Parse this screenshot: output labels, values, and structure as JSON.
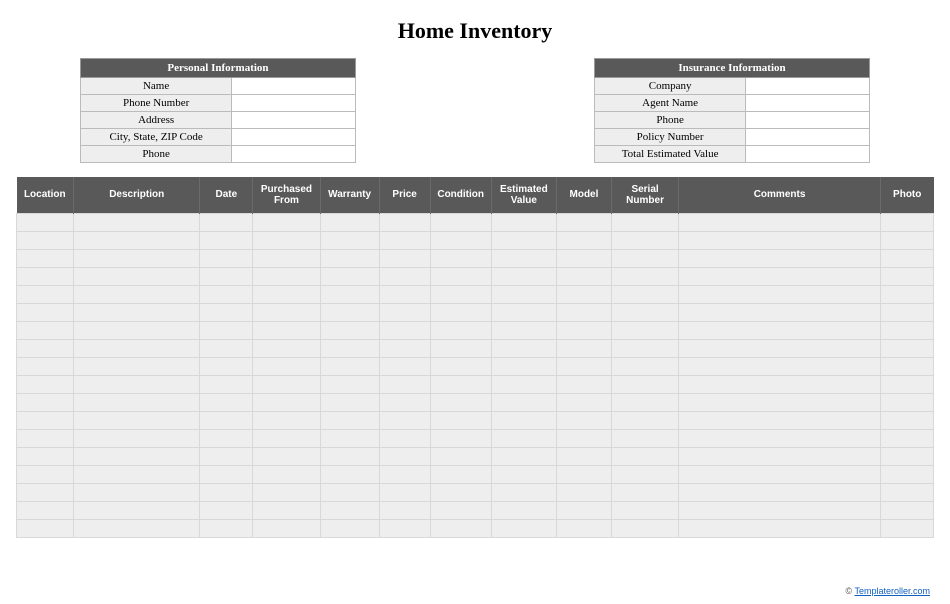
{
  "title": "Home Inventory",
  "personal": {
    "header": "Personal Information",
    "rows": [
      {
        "label": "Name",
        "value": ""
      },
      {
        "label": "Phone Number",
        "value": ""
      },
      {
        "label": "Address",
        "value": ""
      },
      {
        "label": "City, State, ZIP Code",
        "value": ""
      },
      {
        "label": "Phone",
        "value": ""
      }
    ]
  },
  "insurance": {
    "header": "Insurance Information",
    "rows": [
      {
        "label": "Company",
        "value": ""
      },
      {
        "label": "Agent Name",
        "value": ""
      },
      {
        "label": "Phone",
        "value": ""
      },
      {
        "label": "Policy Number",
        "value": ""
      },
      {
        "label": "Total Estimated Value",
        "value": ""
      }
    ]
  },
  "columns": [
    "Location",
    "Description",
    "Date",
    "Purchased From",
    "Warranty",
    "Price",
    "Condition",
    "Estimated Value",
    "Model",
    "Serial Number",
    "Comments",
    "Photo"
  ],
  "row_count": 18,
  "footer": {
    "copyright": "©",
    "link_text": "Templateroller.com"
  }
}
